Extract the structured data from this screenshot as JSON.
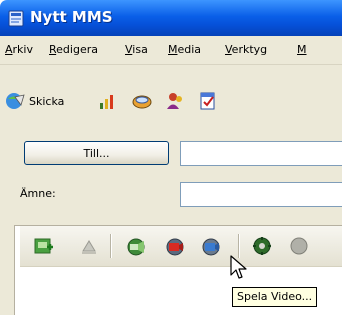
{
  "window": {
    "title": "Nytt MMS",
    "title_icon": "mms-envelope-icon"
  },
  "menu": [
    {
      "underline": "A",
      "rest": "rkiv"
    },
    {
      "underline": "R",
      "rest": "edigera"
    },
    {
      "underline": "V",
      "rest": "isa"
    },
    {
      "underline": "M",
      "rest": "edia"
    },
    {
      "underline": "V",
      "rest": "erktyg"
    },
    {
      "underline": "M",
      "rest": ""
    }
  ],
  "toolbar": {
    "send_label": "Skicka",
    "icons": [
      "send-icon",
      "signal-strength-icon",
      "attach-icon",
      "address-book-icon",
      "spellcheck-icon"
    ]
  },
  "form": {
    "to_button_label": "Till...",
    "to_value": "",
    "subject_label": "Ämne:",
    "subject_value": ""
  },
  "media_toolbar": {
    "icons": [
      "insert-image-icon",
      "disabled-slide-icon",
      "play-sound-icon",
      "record-video-icon",
      "play-video-icon",
      "settings-icon",
      "extra-icon"
    ]
  },
  "tooltip": {
    "text": "Spela Video..."
  },
  "colors": {
    "titlebar": "#0a5fe8",
    "chrome": "#ece9d8",
    "tooltip_bg": "#ffffe1"
  }
}
